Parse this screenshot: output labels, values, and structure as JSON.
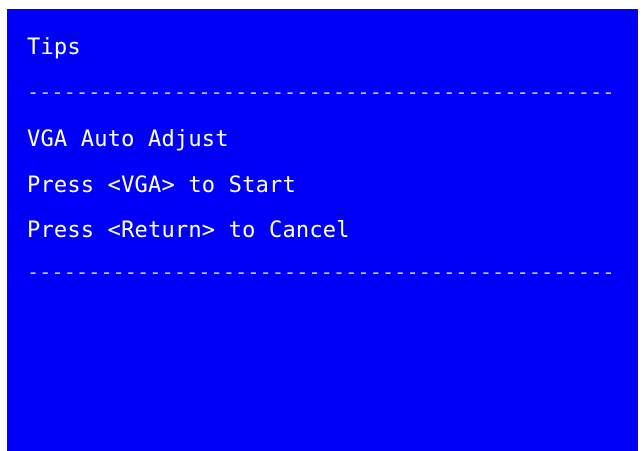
{
  "dialog": {
    "title": "Tips",
    "separator_top": "------------------------------------------------",
    "lines": [
      "VGA Auto Adjust",
      "Press <VGA> to Start",
      "Press <Return> to Cancel"
    ],
    "separator_bottom": "------------------------------------------------"
  },
  "colors": {
    "background": "#0000f8",
    "text": "#ffffff"
  }
}
